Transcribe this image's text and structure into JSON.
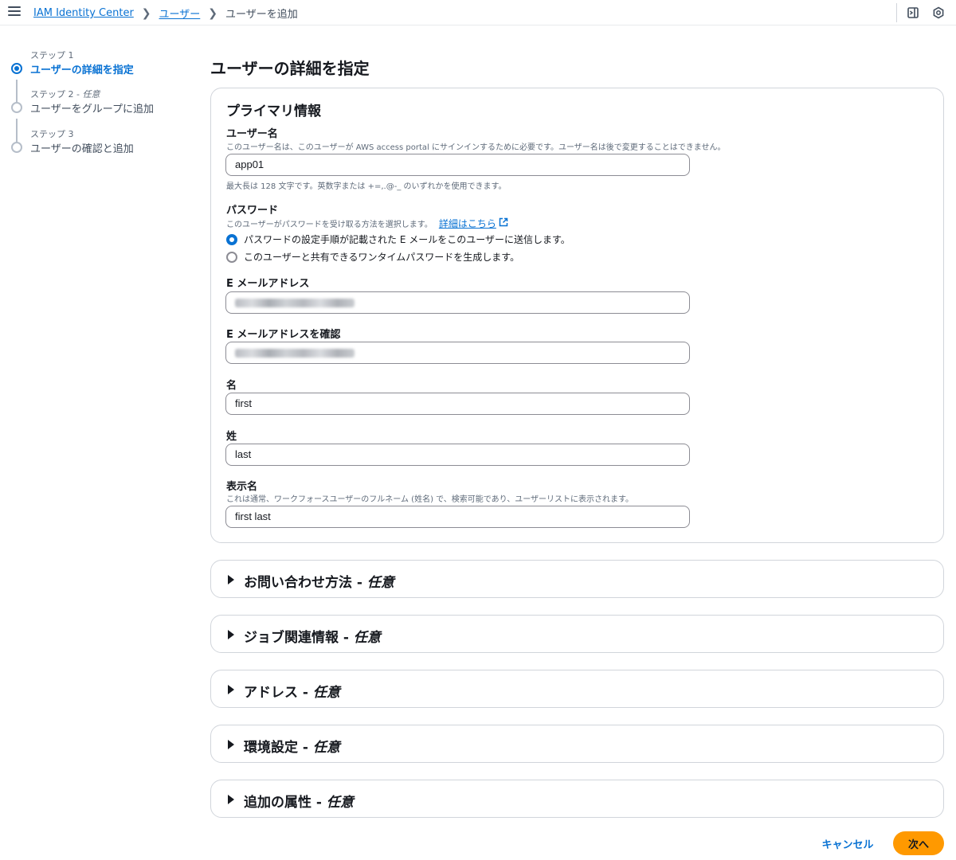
{
  "breadcrumbs": [
    {
      "label": "IAM Identity Center"
    },
    {
      "label": "ユーザー"
    }
  ],
  "breadcrumb_current": "ユーザーを追加",
  "steps": [
    {
      "number": "ステップ 1",
      "optional": "",
      "title": "ユーザーの詳細を指定",
      "active": true
    },
    {
      "number": "ステップ 2 - ",
      "optional": "任意",
      "title": "ユーザーをグループに追加",
      "active": false
    },
    {
      "number": "ステップ 3",
      "optional": "",
      "title": "ユーザーの確認と追加",
      "active": false
    }
  ],
  "page_title": "ユーザーの詳細を指定",
  "primary": {
    "heading": "プライマリ情報",
    "username": {
      "label": "ユーザー名",
      "description": "このユーザー名は、このユーザーが AWS access portal にサインインするために必要です。ユーザー名は後で変更することはできません。",
      "value": "app01",
      "constraint": "最大長は 128 文字です。英数字または +=,.@-_ のいずれかを使用できます。"
    },
    "password": {
      "label": "パスワード",
      "description": "このユーザーがパスワードを受け取る方法を選択します。",
      "link": "詳細はこちら",
      "options": [
        {
          "label": "パスワードの設定手順が記載された E メールをこのユーザーに送信します。",
          "checked": true
        },
        {
          "label": "このユーザーと共有できるワンタイムパスワードを生成します。",
          "checked": false
        }
      ]
    },
    "email": {
      "label": "E メールアドレス"
    },
    "email_confirm": {
      "label": "E メールアドレスを確認"
    },
    "first_name": {
      "label": "名",
      "value": "first"
    },
    "last_name": {
      "label": "姓",
      "value": "last"
    },
    "display_name": {
      "label": "表示名",
      "description": "これは通常、ワークフォースユーザーのフルネーム (姓名) で、検索可能であり、ユーザーリストに表示されます。",
      "value": "first last"
    }
  },
  "sections": [
    {
      "title": "お問い合わせ方法 - ",
      "optional": "任意"
    },
    {
      "title": "ジョブ関連情報 - ",
      "optional": "任意"
    },
    {
      "title": "アドレス - ",
      "optional": "任意"
    },
    {
      "title": "環境設定 - ",
      "optional": "任意"
    },
    {
      "title": "追加の属性 - ",
      "optional": "任意"
    }
  ],
  "actions": {
    "cancel": "キャンセル",
    "next": "次へ"
  },
  "colors": {
    "accent": "#0972d3",
    "primary_button": "#ff9900"
  },
  "icons": [
    "menu-icon",
    "chevron-right-icon",
    "external-link-icon",
    "side-panel-icon",
    "settings-hex-icon",
    "caret-right-icon"
  ]
}
